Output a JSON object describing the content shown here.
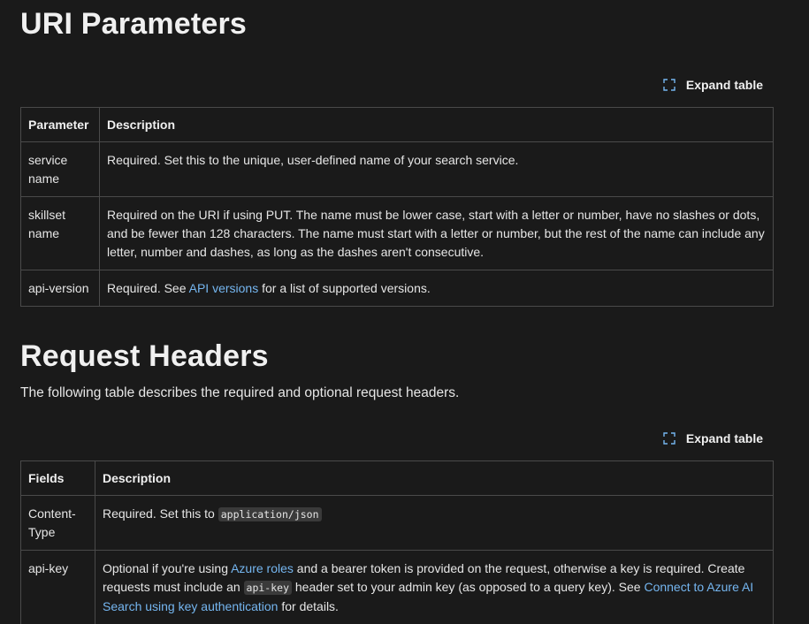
{
  "uri_section": {
    "heading": "URI Parameters",
    "expand_label": "Expand table",
    "columns": [
      "Parameter",
      "Description"
    ],
    "rows": [
      {
        "param": "service name",
        "desc": "Required. Set this to the unique, user-defined name of your search service."
      },
      {
        "param": "skillset name",
        "desc": "Required on the URI if using PUT. The name must be lower case, start with a letter or number, have no slashes or dots, and be fewer than 128 characters. The name must start with a letter or number, but the rest of the name can include any letter, number and dashes, as long as the dashes aren't consecutive."
      },
      {
        "param": "api-version",
        "desc_before": "Required. See ",
        "desc_link": "API versions",
        "desc_after": " for a list of supported versions."
      }
    ]
  },
  "headers_section": {
    "heading": "Request Headers",
    "intro": "The following table describes the required and optional request headers.",
    "expand_label": "Expand table",
    "columns": [
      "Fields",
      "Description"
    ],
    "rows": [
      {
        "field": "Content-Type",
        "desc_before": "Required. Set this to ",
        "desc_code": "application/json"
      },
      {
        "field": "api-key",
        "desc_1": "Optional if you're using ",
        "link_1": "Azure roles",
        "desc_2": " and a bearer token is provided on the request, otherwise a key is required. Create requests must include an ",
        "code": "api-key",
        "desc_3": " header set to your admin key (as opposed to a query key). See ",
        "link_2": "Connect to Azure AI Search using key authentication",
        "desc_4": " for details."
      }
    ]
  }
}
